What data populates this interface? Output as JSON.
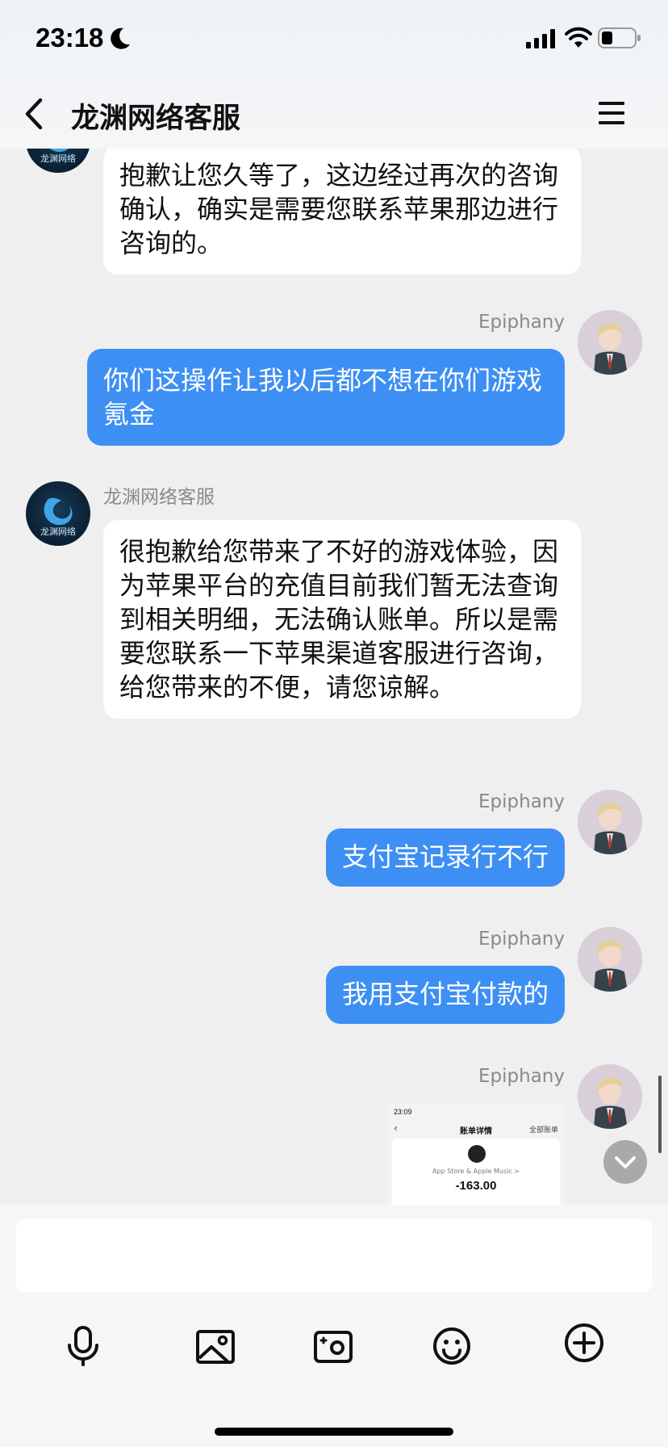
{
  "status_bar": {
    "time": "23:18"
  },
  "nav": {
    "title": "龙渊网络客服"
  },
  "messages": [
    {
      "sender": "",
      "text": "抱歉让您久等了，这边经过再次的咨询确认，确实是需要您联系苹果那边进行咨询的。"
    },
    {
      "sender": "Epiphany",
      "text": "你们这操作让我以后都不想在你们游戏氪金"
    },
    {
      "sender": "龙渊网络客服",
      "text": "很抱歉给您带来了不好的游戏体验，因为苹果平台的充值目前我们暂无法查询到相关明细，无法确认账单。所以是需要您联系一下苹果渠道客服进行咨询，给您带来的不便，请您谅解。"
    },
    {
      "sender": "Epiphany",
      "text": "支付宝记录行不行"
    },
    {
      "sender": "Epiphany",
      "text": "我用支付宝付款的"
    },
    {
      "sender": "Epiphany",
      "text": ""
    }
  ],
  "agent_avatar_text": "龙渊网络",
  "image_message": {
    "time": "23:09",
    "title": "账单详情",
    "all_bills": "全部账单",
    "merchant": "App Store & Apple Music >",
    "amount": "-163.00"
  },
  "input": {
    "placeholder": ""
  },
  "icons": [
    "moon-icon",
    "signal-icon",
    "wifi-icon",
    "battery-icon",
    "back-icon",
    "menu-icon",
    "microphone-icon",
    "image-icon",
    "camera-icon",
    "emoji-icon",
    "plus-icon",
    "chevron-down-icon"
  ],
  "colors": {
    "accent": "#3d8ff3",
    "background": "#efefef",
    "bubble_in": "#ffffff"
  }
}
